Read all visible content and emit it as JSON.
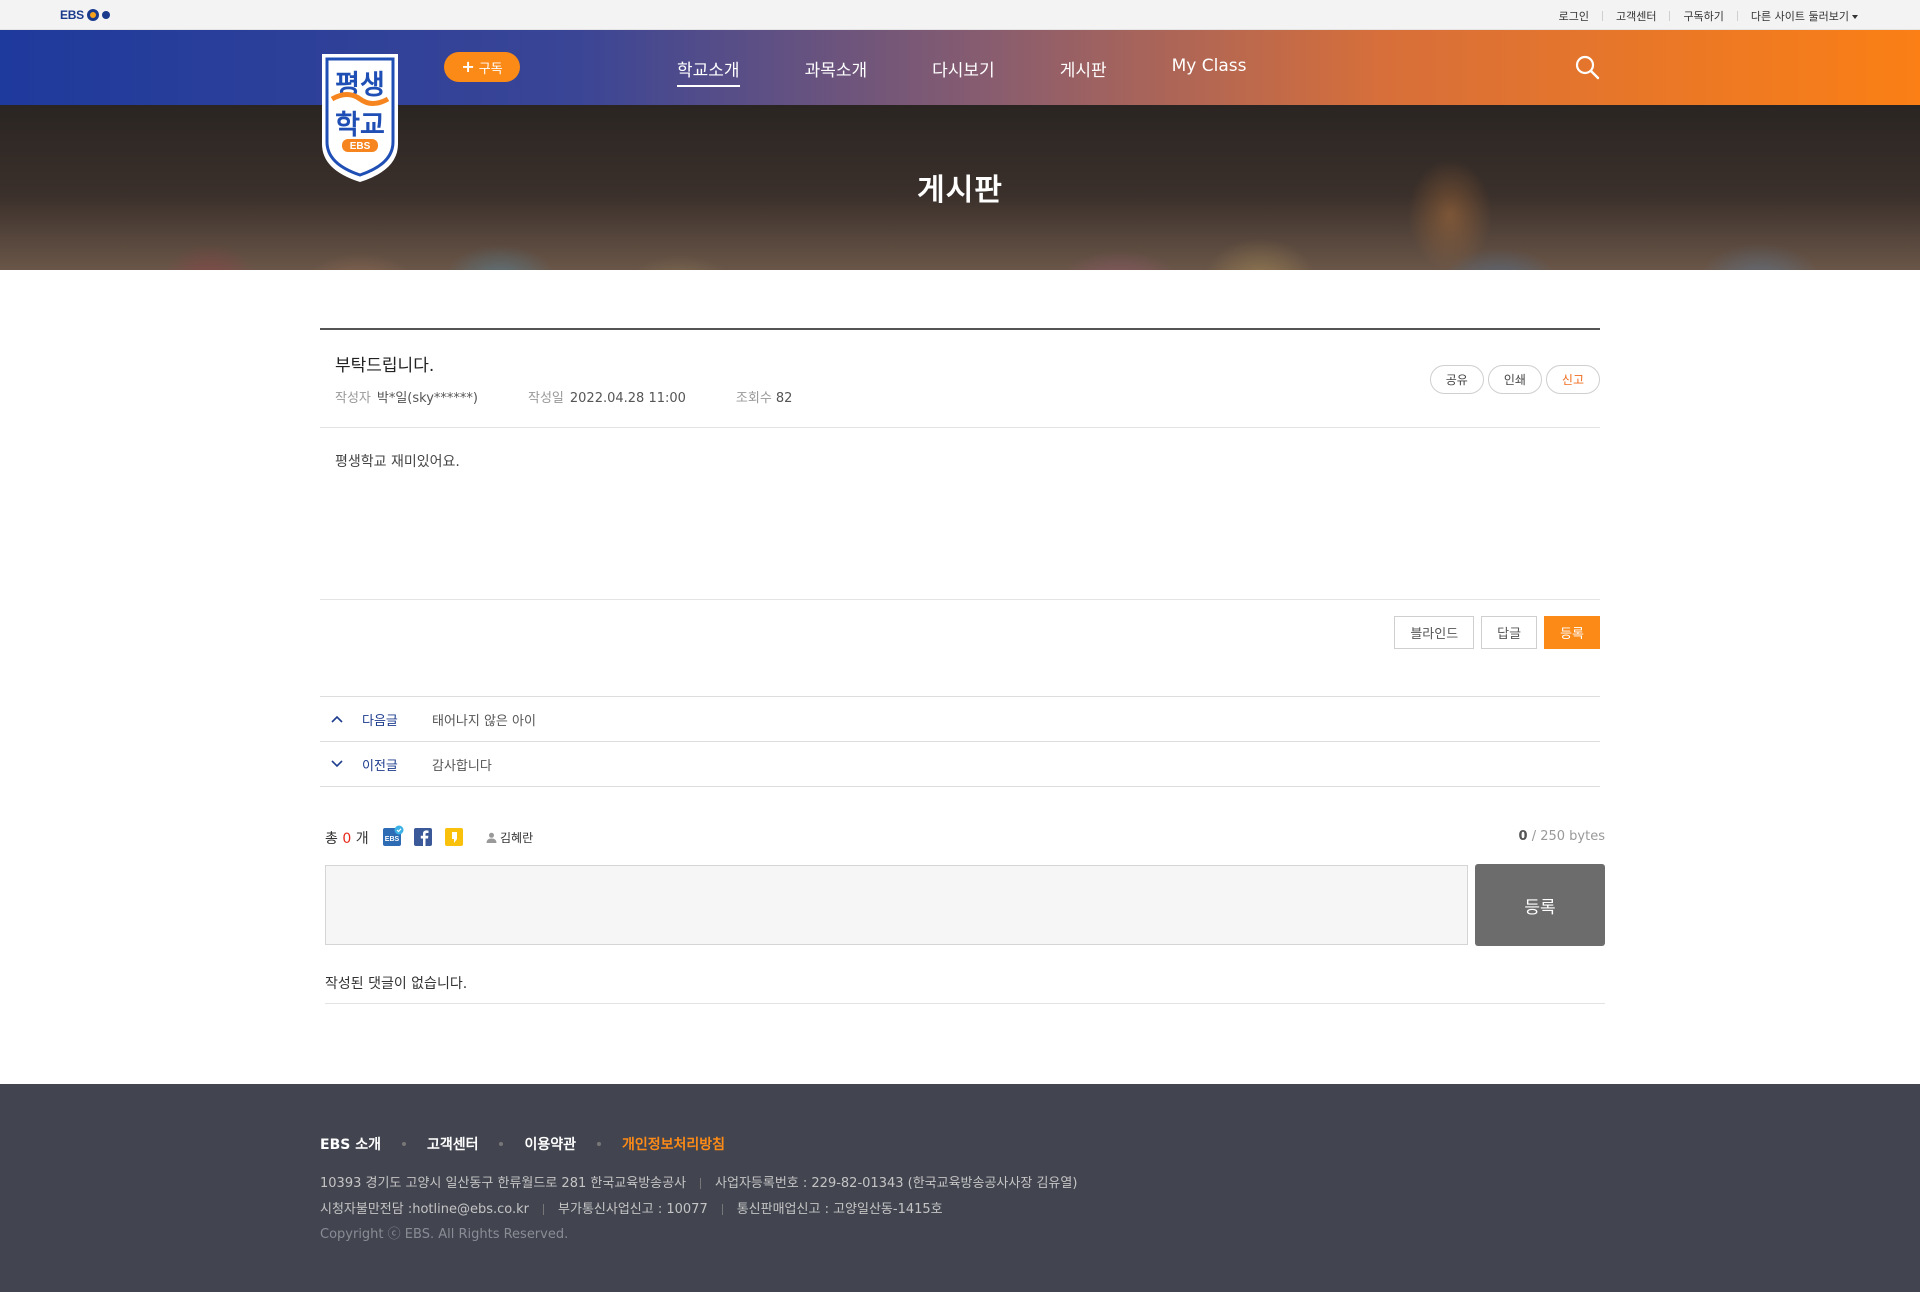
{
  "util_bar": {
    "logo_text": "EBS",
    "links": [
      "로그인",
      "고객센터",
      "구독하기",
      "다른 사이트 둘러보기"
    ]
  },
  "header": {
    "logo_text_line1": "평생",
    "logo_text_line2": "학교",
    "logo_badge": "EBS",
    "subscribe_label": "구독",
    "nav": [
      "학교소개",
      "과목소개",
      "다시보기",
      "게시판",
      "My Class"
    ],
    "active_nav": "학교소개",
    "colors": {
      "blue": "#1e3a9c",
      "orange": "#fb7f15"
    }
  },
  "visual": {
    "title": "게시판"
  },
  "post": {
    "title": "부탁드립니다.",
    "author_label": "작성자",
    "author": "박*일(sky******)",
    "date_label": "작성일",
    "date": "2022.04.28 11:00",
    "views_label": "조회수",
    "views": "82",
    "actions": {
      "share": "공유",
      "print": "인쇄",
      "report": "신고"
    },
    "body": "평생학교 재미있어요."
  },
  "post_buttons": {
    "blind": "블라인드",
    "reply": "답글",
    "write": "등록"
  },
  "nav_list": {
    "next_label": "다음글",
    "next_title": "태어나지 않은 아이",
    "prev_label": "이전글",
    "prev_title": "감사합니다"
  },
  "comments": {
    "total_prefix": "총",
    "total_count": "0",
    "total_suffix": "개",
    "user_name": "김혜란",
    "bytes_current": "0",
    "bytes_max": " / 250 bytes",
    "submit_label": "등록",
    "empty_text": "작성된 댓글이 없습니다.",
    "sns_icons": [
      "ebs-icon",
      "facebook-icon",
      "kakaostory-icon"
    ]
  },
  "footer": {
    "links": [
      "EBS 소개",
      "고객센터",
      "이용약관",
      "개인정보처리방침"
    ],
    "address": "10393 경기도 고양시 일산동구 한류월드로 281 한국교육방송공사",
    "business_no": "사업자등록번호 : 229-82-01343 (한국교육방송공사사장 김유열)",
    "complaint": "시청자불만전담 :hotline@ebs.co.kr",
    "telecom": "부가통신사업신고 : 10077",
    "ecommerce": "통신판매업신고 : 고양일산동-1415호",
    "copyright": "Copyright ⓒ EBS. All Rights Reserved."
  }
}
